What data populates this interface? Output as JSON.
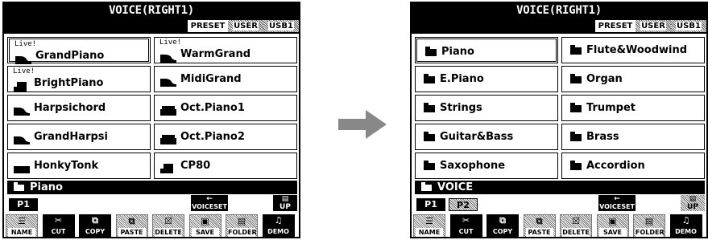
{
  "left": {
    "title": "VOICE(RIGHT1)",
    "tabs": [
      "PRESET",
      "USER",
      "USB1"
    ],
    "voices": [
      {
        "name": "GrandPiano",
        "live": "Live!",
        "icon": "grand-piano",
        "selected": true
      },
      {
        "name": "WarmGrand",
        "live": "Live!",
        "icon": "grand-piano",
        "selected": false
      },
      {
        "name": "BrightPiano",
        "live": "Live!",
        "icon": "upright-piano",
        "selected": false
      },
      {
        "name": "MidiGrand",
        "live": "",
        "icon": "grand-piano",
        "selected": false
      },
      {
        "name": "Harpsichord",
        "live": "",
        "icon": "grand-piano",
        "selected": false
      },
      {
        "name": "Oct.Piano1",
        "live": "",
        "icon": "keyboard",
        "selected": false
      },
      {
        "name": "GrandHarpsi",
        "live": "",
        "icon": "grand-piano",
        "selected": false
      },
      {
        "name": "Oct.Piano2",
        "live": "",
        "icon": "keyboard",
        "selected": false
      },
      {
        "name": "HonkyTonk",
        "live": "",
        "icon": "synth",
        "selected": false
      },
      {
        "name": "CP80",
        "live": "",
        "icon": "upright-piano",
        "selected": false
      }
    ],
    "path": "Piano",
    "pages": [
      "P1"
    ],
    "voiceset": "VOICESET",
    "up": "UP"
  },
  "right": {
    "title": "VOICE(RIGHT1)",
    "tabs": [
      "PRESET",
      "USER",
      "USB1"
    ],
    "folders": [
      "Piano",
      "Flute&Woodwind",
      "E.Piano",
      "Organ",
      "Strings",
      "Trumpet",
      "Guitar&Bass",
      "Brass",
      "Saxophone",
      "Accordion"
    ],
    "path": "VOICE",
    "pages": [
      "P1",
      "P2"
    ],
    "voiceset": "VOICESET",
    "up": "UP"
  },
  "toolbar": [
    "NAME",
    "CUT",
    "COPY",
    "PASTE",
    "DELETE",
    "SAVE",
    "FOLDER",
    "DEMO"
  ],
  "arrow_color": "#888888"
}
